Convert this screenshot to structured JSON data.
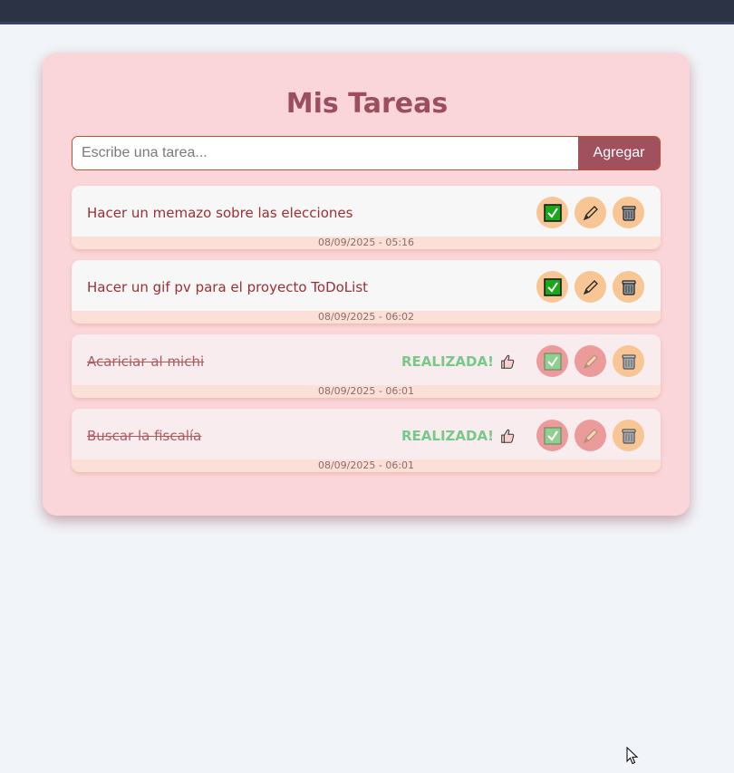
{
  "header": {
    "title": "Mis Tareas"
  },
  "form": {
    "placeholder": "Escribe una tarea...",
    "add_label": "Agregar"
  },
  "tasks": [
    {
      "text": "Hacer un memazo sobre las elecciones",
      "date": "08/09/2025 - 05:16",
      "done": false,
      "status": ""
    },
    {
      "text": "Hacer un gif pv para el proyecto ToDoList",
      "date": "08/09/2025 - 06:02",
      "done": false,
      "status": ""
    },
    {
      "text": "Acariciar al michi",
      "date": "08/09/2025 - 06:01",
      "done": true,
      "status": "REALIZADA!"
    },
    {
      "text": "Buscar la fiscalía",
      "date": "08/09/2025 - 06:01",
      "done": true,
      "status": "REALIZADA!"
    }
  ],
  "icons": {
    "check": "check-box-icon",
    "edit": "pencil-icon",
    "delete": "trash-can-icon",
    "status": "thumbs-up-icon"
  },
  "colors": {
    "card": "#fad6da",
    "accent": "#a1505e",
    "done_label": "#78c88a"
  }
}
